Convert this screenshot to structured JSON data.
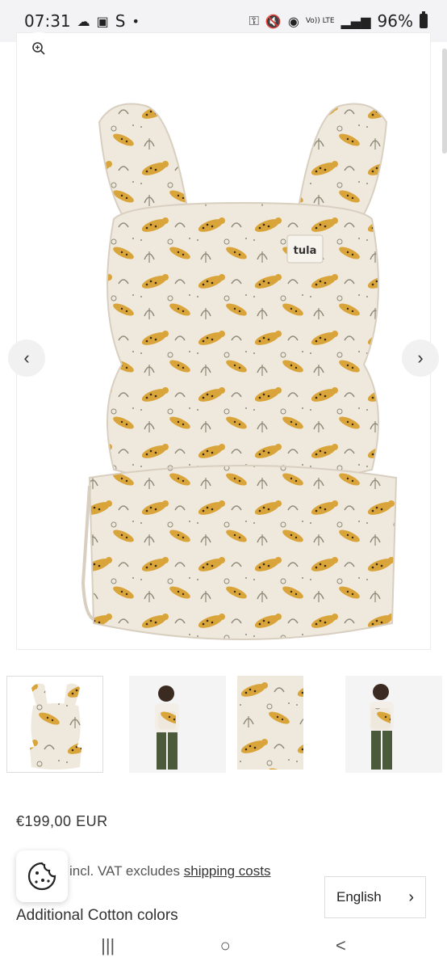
{
  "status_bar": {
    "time": "07:31",
    "carrier_glyph": "S",
    "battery": "96%",
    "icons": [
      "cloud-icon",
      "image-icon",
      "dot-icon",
      "key-icon",
      "mute-icon",
      "wifi-icon",
      "volte-icon",
      "signal-icon",
      "battery-icon"
    ],
    "volte_label": "Vo)) LTE"
  },
  "product": {
    "brand_tag": "tula",
    "price": "€199,00 EUR",
    "tax_prefix": "incl. VAT excludes",
    "shipping_link": "shipping costs",
    "colors_heading": "Additional Cotton colors"
  },
  "gallery": {
    "thumbnails": [
      "carrier-front",
      "model-front",
      "carrier-detail",
      "model-side"
    ],
    "active_index": 0
  },
  "language": {
    "selected": "English"
  },
  "nav": {
    "recent_glyph": "|||",
    "home_glyph": "○",
    "back_glyph": "<"
  },
  "colors": {
    "pattern_base": "#efe8dc",
    "leopard": "#d9a53a",
    "leaf": "#8d8b78"
  }
}
